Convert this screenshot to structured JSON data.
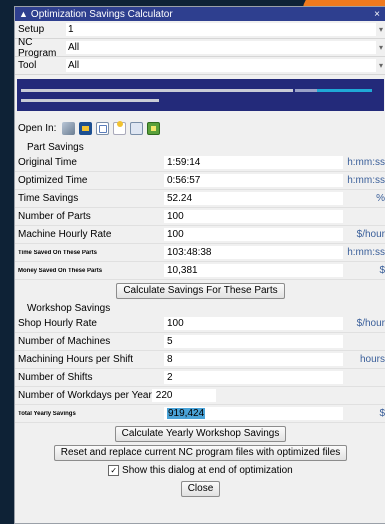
{
  "window": {
    "title": "Optimization Savings Calculator",
    "close_glyph": "×"
  },
  "selectors": [
    {
      "label": "Setup",
      "value": "1"
    },
    {
      "label": "NC Program",
      "value": "All"
    },
    {
      "label": "Tool",
      "value": "All"
    }
  ],
  "progress": {
    "bar1_fraction": 0.78,
    "bar2_fraction": 0.38
  },
  "open_in": {
    "label": "Open In:",
    "icons": [
      "cnc-machine-icon",
      "nc-editor-icon",
      "graph-viewer-icon",
      "sticky-note-icon",
      "text-report-icon",
      "spreadsheet-icon"
    ]
  },
  "part_savings": {
    "title": "Part Savings",
    "rows": [
      {
        "label": "Original Time",
        "value": "1:59:14",
        "unit": "h:mm:ss"
      },
      {
        "label": "Optimized Time",
        "value": "0:56:57",
        "unit": "h:mm:ss"
      },
      {
        "label": "Time Savings",
        "value": "52.24",
        "unit": "%"
      },
      {
        "label": "Number of Parts",
        "value": "100",
        "unit": ""
      },
      {
        "label": "Machine Hourly Rate",
        "value": "100",
        "unit": "$/hour"
      },
      {
        "label": "Time Saved On These Parts",
        "value": "103:48:38",
        "unit": "h:mm:ss"
      },
      {
        "label": "Money Saved On These Parts",
        "value": "10,381",
        "unit": "$"
      }
    ],
    "button": "Calculate Savings For These Parts"
  },
  "workshop_savings": {
    "title": "Workshop Savings",
    "rows": [
      {
        "label": "Shop Hourly Rate",
        "value": "100",
        "unit": "$/hour"
      },
      {
        "label": "Number of Machines",
        "value": "5",
        "unit": ""
      },
      {
        "label": "Machining Hours per Shift",
        "value": "8",
        "unit": "hours"
      },
      {
        "label": "Number of Shifts",
        "value": "2",
        "unit": ""
      }
    ],
    "workdays_label": "Number of Workdays per Year",
    "workdays_value": "220",
    "total_label": "Total Yearly Savings",
    "total_value": "919,424",
    "total_unit": "$",
    "button": "Calculate Yearly Workshop Savings"
  },
  "reset_button": "Reset and replace current NC program files with optimized files",
  "show_dialog": {
    "checked": true,
    "label": "Show this dialog at end of optimization",
    "check_glyph": "✓"
  },
  "close_button": "Close",
  "colors": {
    "titlebar": "#2e3f8f",
    "progress_panel": "#232a7a",
    "highlight": "#4aa3d8",
    "accent": "#f07a1e"
  }
}
